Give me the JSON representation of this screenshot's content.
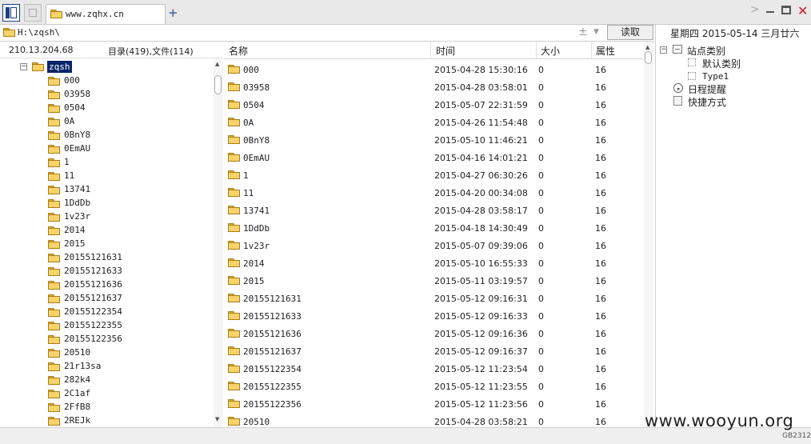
{
  "tabs": [
    {
      "label": "www.zqhx.cn"
    }
  ],
  "address": {
    "path": "H:\\zqsh\\",
    "read_label": "读取"
  },
  "info": {
    "ip": "210.13.204.68",
    "dir_summary": "目录(419),文件(114)"
  },
  "tree": {
    "root": "zqsh",
    "items": [
      "000",
      "03958",
      "0504",
      "0A",
      "0BnY8",
      "0EmAU",
      "1",
      "11",
      "13741",
      "1DdDb",
      "1v23r",
      "2014",
      "2015",
      "20155121631",
      "20155121633",
      "20155121636",
      "20155121637",
      "20155122354",
      "20155122355",
      "20155122356",
      "20510",
      "21r13sa",
      "282k4",
      "2C1af",
      "2FfB8",
      "2REJk"
    ]
  },
  "files": {
    "columns": {
      "name": "名称",
      "time": "时间",
      "size": "大小",
      "attr": "属性"
    },
    "rows": [
      {
        "name": "000",
        "time": "2015-04-28 15:30:16",
        "size": "0",
        "attr": "16"
      },
      {
        "name": "03958",
        "time": "2015-04-28 03:58:01",
        "size": "0",
        "attr": "16"
      },
      {
        "name": "0504",
        "time": "2015-05-07 22:31:59",
        "size": "0",
        "attr": "16"
      },
      {
        "name": "0A",
        "time": "2015-04-26 11:54:48",
        "size": "0",
        "attr": "16"
      },
      {
        "name": "0BnY8",
        "time": "2015-05-10 11:46:21",
        "size": "0",
        "attr": "16"
      },
      {
        "name": "0EmAU",
        "time": "2015-04-16 14:01:21",
        "size": "0",
        "attr": "16"
      },
      {
        "name": "1",
        "time": "2015-04-27 06:30:26",
        "size": "0",
        "attr": "16"
      },
      {
        "name": "11",
        "time": "2015-04-20 00:34:08",
        "size": "0",
        "attr": "16"
      },
      {
        "name": "13741",
        "time": "2015-04-28 03:58:17",
        "size": "0",
        "attr": "16"
      },
      {
        "name": "1DdDb",
        "time": "2015-04-18 14:30:49",
        "size": "0",
        "attr": "16"
      },
      {
        "name": "1v23r",
        "time": "2015-05-07 09:39:06",
        "size": "0",
        "attr": "16"
      },
      {
        "name": "2014",
        "time": "2015-05-10 16:55:33",
        "size": "0",
        "attr": "16"
      },
      {
        "name": "2015",
        "time": "2015-05-11 03:19:57",
        "size": "0",
        "attr": "16"
      },
      {
        "name": "20155121631",
        "time": "2015-05-12 09:16:31",
        "size": "0",
        "attr": "16"
      },
      {
        "name": "20155121633",
        "time": "2015-05-12 09:16:33",
        "size": "0",
        "attr": "16"
      },
      {
        "name": "20155121636",
        "time": "2015-05-12 09:16:36",
        "size": "0",
        "attr": "16"
      },
      {
        "name": "20155121637",
        "time": "2015-05-12 09:16:37",
        "size": "0",
        "attr": "16"
      },
      {
        "name": "20155122354",
        "time": "2015-05-12 11:23:54",
        "size": "0",
        "attr": "16"
      },
      {
        "name": "20155122355",
        "time": "2015-05-12 11:23:55",
        "size": "0",
        "attr": "16"
      },
      {
        "name": "20155122356",
        "time": "2015-05-12 11:23:56",
        "size": "0",
        "attr": "16"
      },
      {
        "name": "20510",
        "time": "2015-04-28 03:58:21",
        "size": "0",
        "attr": "16"
      }
    ]
  },
  "right_panel": {
    "date": "星期四 2015-05-14 三月廿六",
    "site_category": "站点类别",
    "default_category": "默认类别",
    "type1": "Type1",
    "schedule": "日程提醒",
    "shortcut": "快捷方式"
  },
  "watermark": "www.wooyun.org",
  "encoding": "GB2312"
}
